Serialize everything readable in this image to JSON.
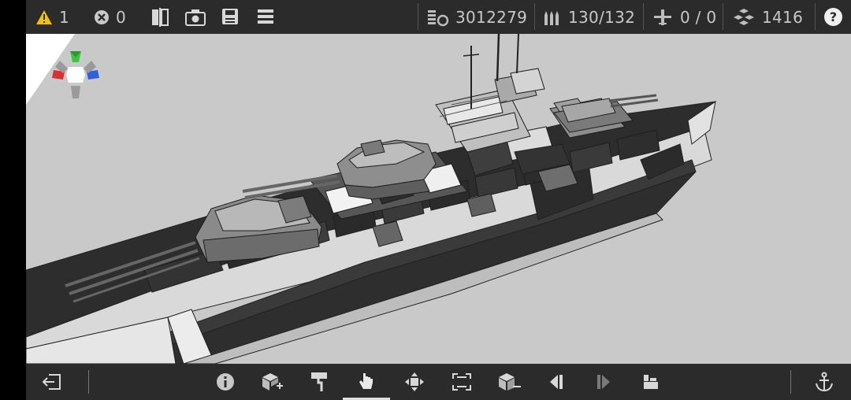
{
  "status": {
    "warnings": {
      "icon": "warning-triangle-icon",
      "count": "1",
      "color": "#f2c200"
    },
    "errors": {
      "icon": "error-circle-icon",
      "count": "0"
    }
  },
  "toolbar_icons": [
    "symmetry-icon",
    "screenshot-camera-icon",
    "save-disk-icon",
    "menu-list-icon"
  ],
  "stats": {
    "cost": {
      "icon": "cost-coins-icon",
      "value": "3012279"
    },
    "ammo": {
      "icon": "ammo-shells-icon",
      "value": "130/132"
    },
    "aircraft": {
      "icon": "aircraft-icon",
      "value": "0 / 0"
    },
    "parts": {
      "icon": "parts-blocks-icon",
      "value": "1416"
    }
  },
  "help": {
    "icon": "help-icon",
    "label": "?"
  },
  "axis_gizmo": {
    "colors": {
      "y": "#3fc63f",
      "x": "#d93030",
      "z": "#2f5fe0",
      "neg": "#9a9a9a"
    }
  },
  "bottom_tools": [
    {
      "name": "exit-icon"
    },
    {
      "name": "info-icon"
    },
    {
      "name": "add-block-icon"
    },
    {
      "name": "paint-roller-icon"
    },
    {
      "name": "select-hand-icon",
      "active": true
    },
    {
      "name": "move-icon"
    },
    {
      "name": "resize-icon"
    },
    {
      "name": "remove-block-icon"
    },
    {
      "name": "undo-icon"
    },
    {
      "name": "redo-icon"
    },
    {
      "name": "stack-blocks-icon"
    },
    {
      "name": "anchor-icon"
    }
  ]
}
